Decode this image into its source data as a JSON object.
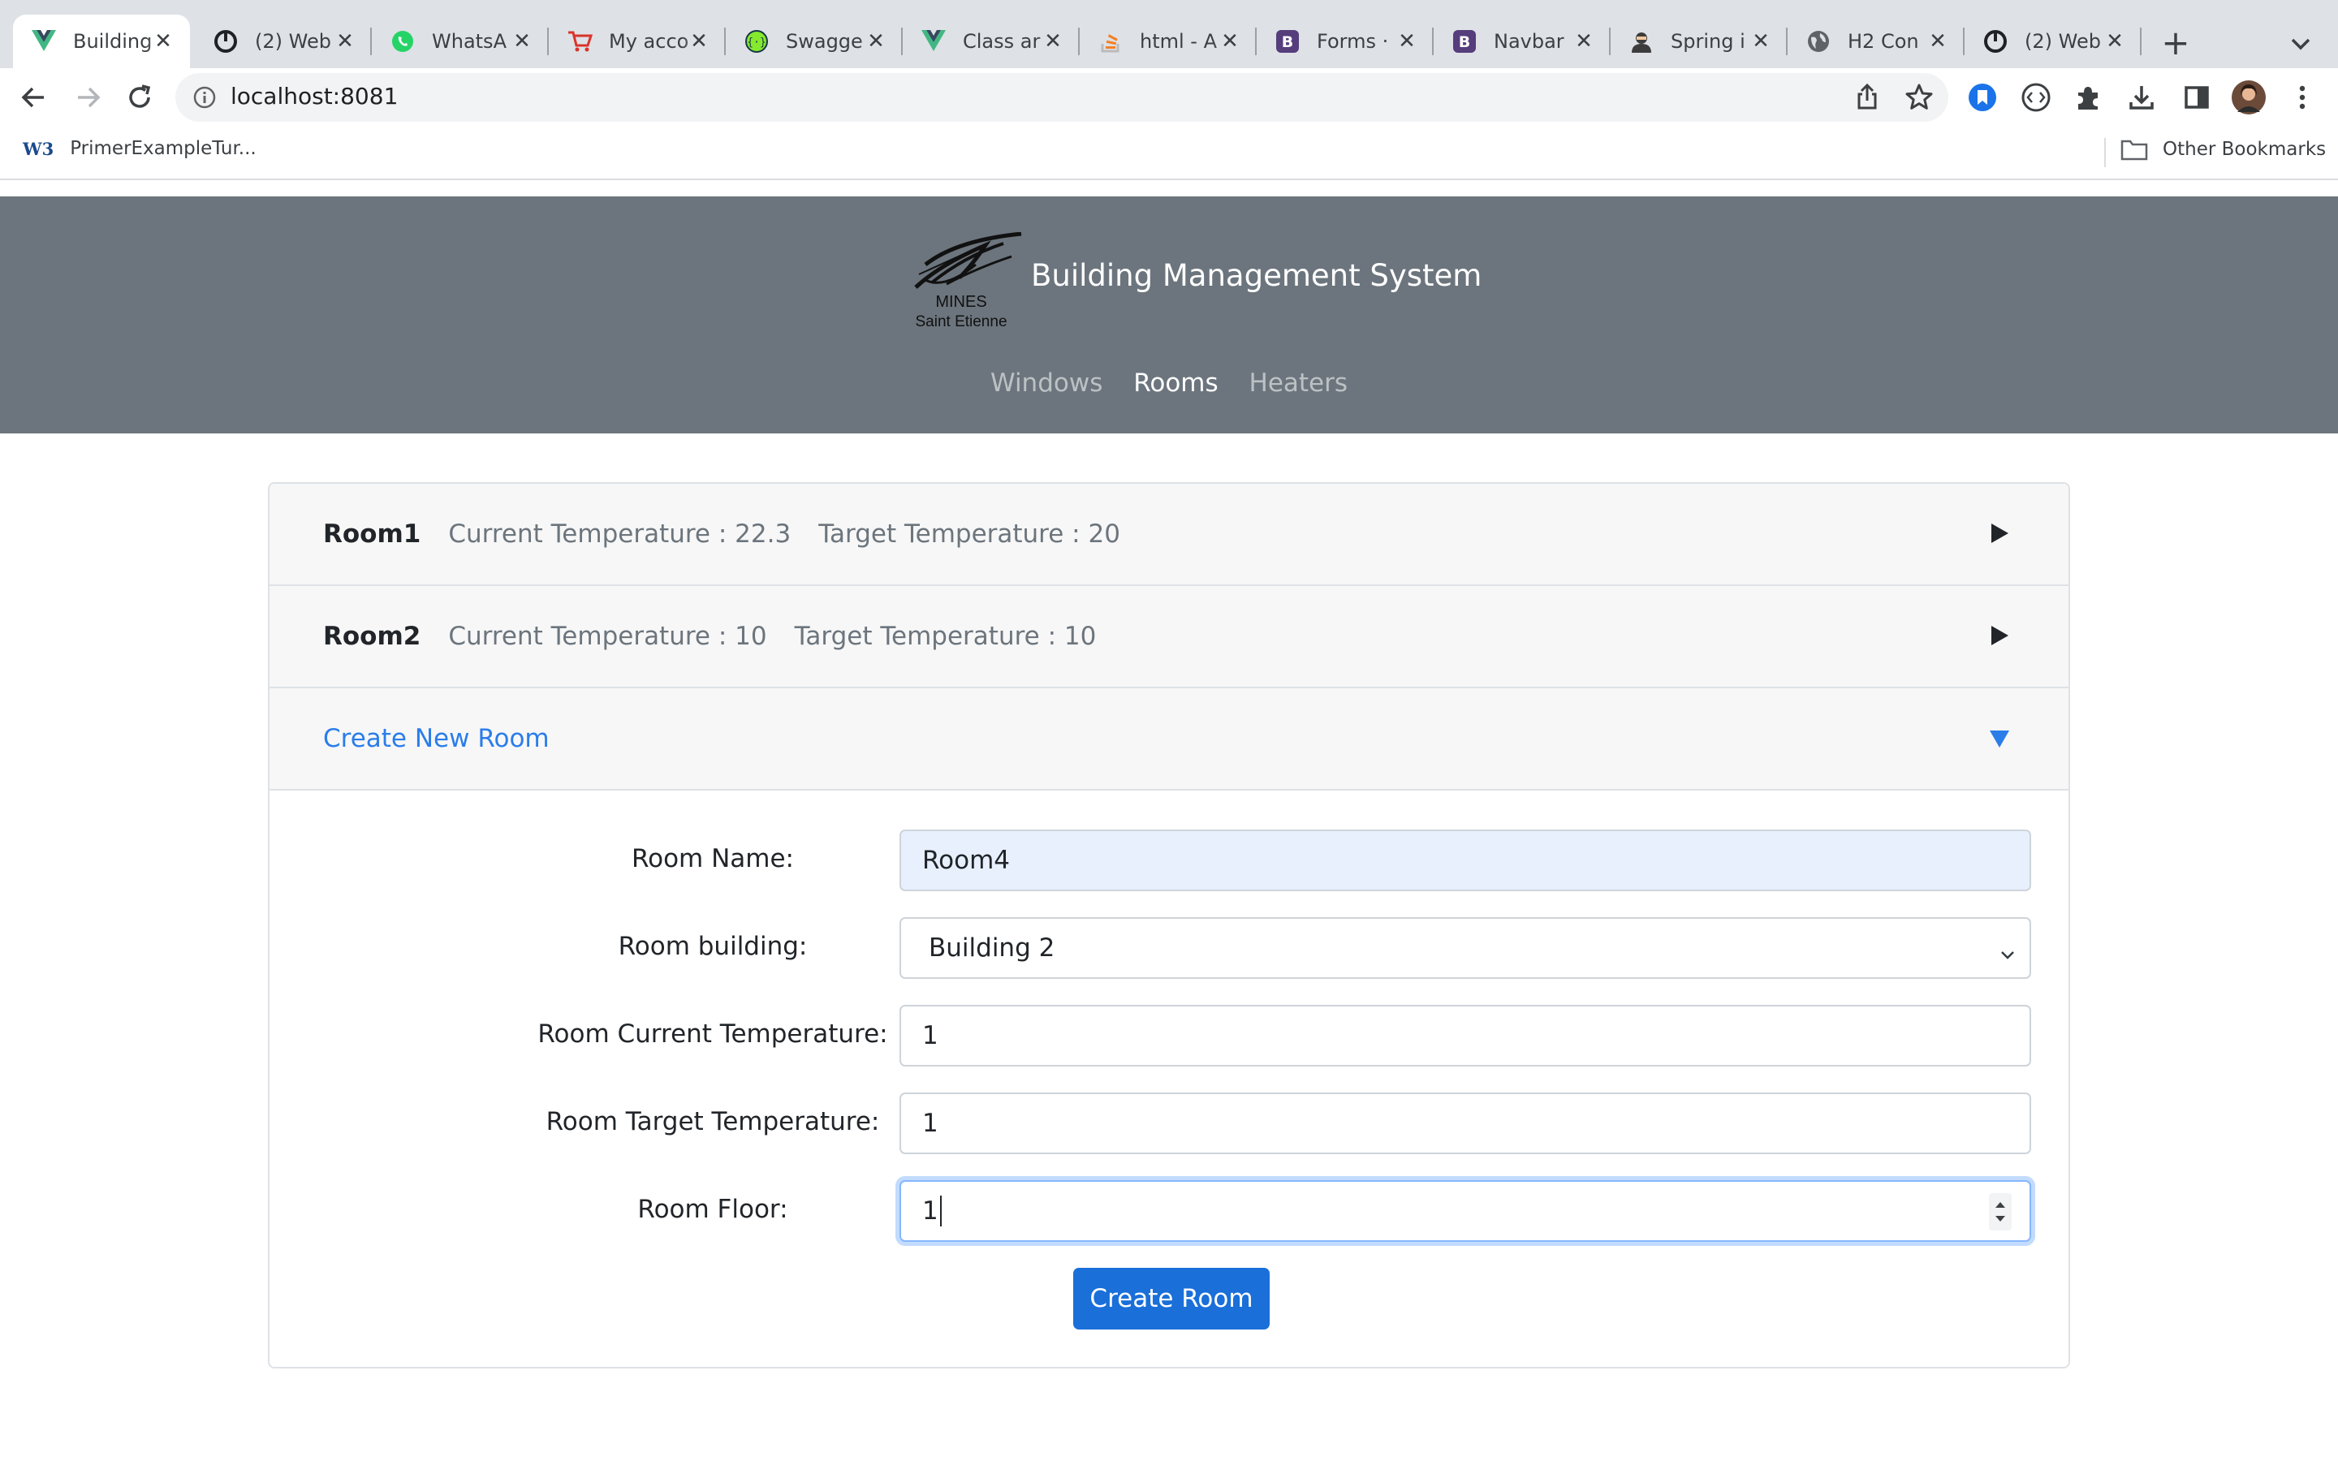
{
  "browser": {
    "tabs": [
      {
        "title": "Building",
        "icon": "vue-icon",
        "active": true
      },
      {
        "title": "(2) Web",
        "icon": "power-icon",
        "active": false
      },
      {
        "title": "WhatsA",
        "icon": "whatsapp-icon",
        "active": false
      },
      {
        "title": "My acco",
        "icon": "cart-icon",
        "active": false
      },
      {
        "title": "Swagge",
        "icon": "swagger-icon",
        "active": false
      },
      {
        "title": "Class ar",
        "icon": "vue-icon",
        "active": false
      },
      {
        "title": "html - A",
        "icon": "stackoverflow-icon",
        "active": false
      },
      {
        "title": "Forms ·",
        "icon": "bootstrap-icon",
        "active": false
      },
      {
        "title": "Navbar",
        "icon": "bootstrap-icon",
        "active": false
      },
      {
        "title": "Spring i",
        "icon": "user-avatar-icon",
        "active": false
      },
      {
        "title": "H2 Con",
        "icon": "globe-icon",
        "active": false
      },
      {
        "title": "(2) Web",
        "icon": "power-icon",
        "active": false
      }
    ],
    "url": "localhost:8081",
    "bookmarks": [
      {
        "label": "PrimerExampleTur...",
        "icon": "w3-icon"
      }
    ],
    "other_bookmarks": "Other Bookmarks"
  },
  "header": {
    "logo_text_line1": "MINES",
    "logo_text_line2": "Saint Etienne",
    "title": "Building Management System",
    "nav": [
      {
        "label": "Windows",
        "active": false
      },
      {
        "label": "Rooms",
        "active": true
      },
      {
        "label": "Heaters",
        "active": false
      }
    ]
  },
  "rooms": [
    {
      "name": "Room1",
      "current_label": "Current Temperature : 22.3",
      "target_label": "Target Temperature : 20"
    },
    {
      "name": "Room2",
      "current_label": "Current Temperature : 10",
      "target_label": "Target Temperature : 10"
    }
  ],
  "create": {
    "header": "Create New Room",
    "fields": {
      "name": {
        "label": "Room Name:",
        "value": "Room4"
      },
      "building": {
        "label": "Room building:",
        "value": "Building 2"
      },
      "current": {
        "label": "Room Current Temperature:",
        "value": "1"
      },
      "target": {
        "label": "Room Target Temperature:",
        "value": "1"
      },
      "floor": {
        "label": "Room Floor:",
        "value": "1"
      }
    },
    "submit": "Create Room"
  },
  "colors": {
    "header_bg": "#6c757d",
    "accent": "#2b7de9",
    "button": "#1a6fd9",
    "autofill": "#e8f0fe"
  }
}
